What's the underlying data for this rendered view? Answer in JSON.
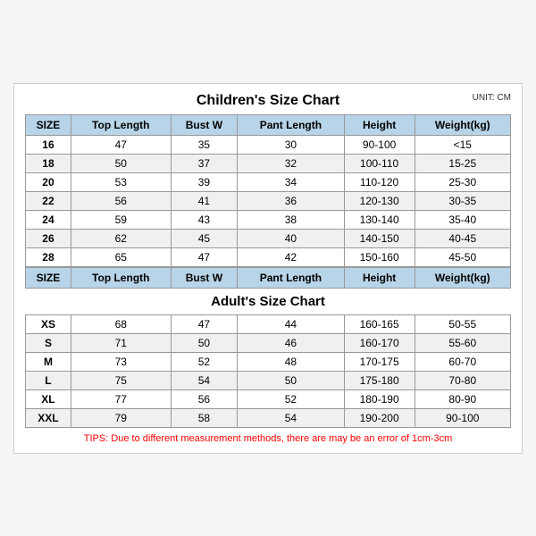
{
  "chart": {
    "title": "Children's Size Chart",
    "unit": "UNIT: CM",
    "children_headers": [
      "SIZE",
      "Top Length",
      "Bust W",
      "Pant Length",
      "Height",
      "Weight(kg)"
    ],
    "children_rows": [
      [
        "16",
        "47",
        "35",
        "30",
        "90-100",
        "<15"
      ],
      [
        "18",
        "50",
        "37",
        "32",
        "100-110",
        "15-25"
      ],
      [
        "20",
        "53",
        "39",
        "34",
        "110-120",
        "25-30"
      ],
      [
        "22",
        "56",
        "41",
        "36",
        "120-130",
        "30-35"
      ],
      [
        "24",
        "59",
        "43",
        "38",
        "130-140",
        "35-40"
      ],
      [
        "26",
        "62",
        "45",
        "40",
        "140-150",
        "40-45"
      ],
      [
        "28",
        "65",
        "47",
        "42",
        "150-160",
        "45-50"
      ]
    ],
    "adults_title": "Adult's Size Chart",
    "adults_headers": [
      "SIZE",
      "Top Length",
      "Bust W",
      "Pant Length",
      "Height",
      "Weight(kg)"
    ],
    "adults_rows": [
      [
        "XS",
        "68",
        "47",
        "44",
        "160-165",
        "50-55"
      ],
      [
        "S",
        "71",
        "50",
        "46",
        "160-170",
        "55-60"
      ],
      [
        "M",
        "73",
        "52",
        "48",
        "170-175",
        "60-70"
      ],
      [
        "L",
        "75",
        "54",
        "50",
        "175-180",
        "70-80"
      ],
      [
        "XL",
        "77",
        "56",
        "52",
        "180-190",
        "80-90"
      ],
      [
        "XXL",
        "79",
        "58",
        "54",
        "190-200",
        "90-100"
      ]
    ],
    "tips": "TIPS: Due to different measurement methods, there are may be an error of 1cm-3cm"
  }
}
